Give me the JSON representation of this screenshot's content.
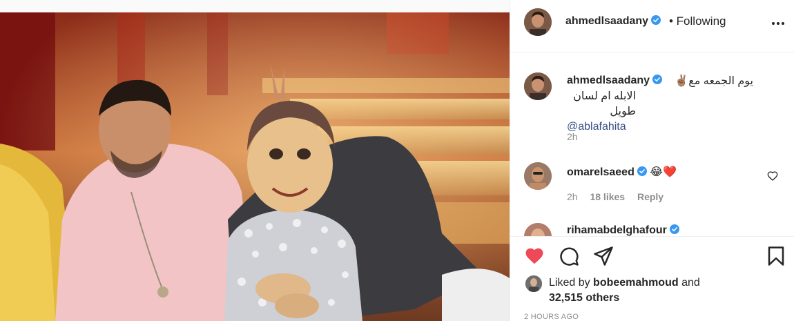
{
  "post": {
    "author": "ahmedlsaadany",
    "follow_status": "• Following",
    "caption_line1": "يوم الجمعه مع✌🏽",
    "caption_line2": "الابله ام لسان طويل",
    "caption_mention": "@ablafahita",
    "caption_time": "2h"
  },
  "comments": [
    {
      "username": "omarelsaeed",
      "text": "😂❤️",
      "time": "2h",
      "likes": "18 likes",
      "reply": "Reply"
    },
    {
      "username": "rihamabdelghafour"
    }
  ],
  "likes": {
    "prefix": "Liked by",
    "user": "bobeemahmoud",
    "and": "and",
    "count": "32,515 others"
  },
  "timestamp": "2 HOURS AGO",
  "colors": {
    "verified": "#3897f0",
    "like_red": "#ed4956",
    "mention": "#385185",
    "muted": "#8e8e8e"
  },
  "icons": [
    "verified-badge-icon",
    "more-options-icon",
    "heart-icon",
    "comment-icon",
    "share-icon",
    "bookmark-icon"
  ]
}
